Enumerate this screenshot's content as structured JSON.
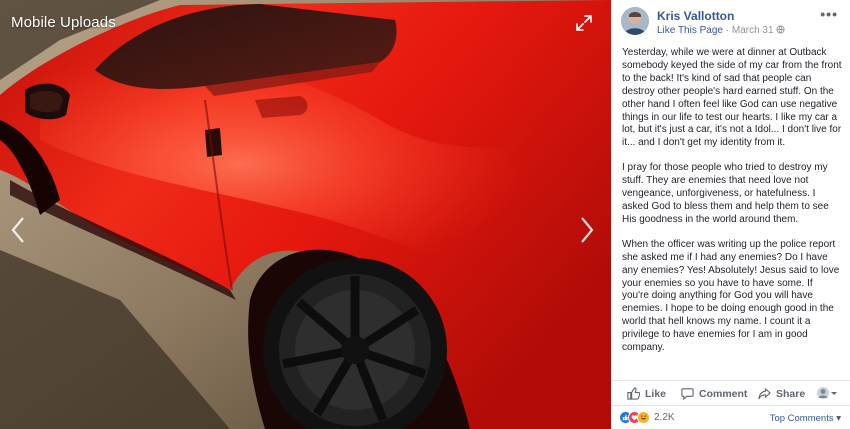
{
  "viewer": {
    "album_title": "Mobile Uploads"
  },
  "post": {
    "author": "Kris Vallotton",
    "like_page": "Like This Page",
    "date": "March 31",
    "paragraphs": [
      "Yesterday, while we were at dinner at Outback somebody keyed the side of my car from the front to the back! It's kind of sad that people can destroy other people's hard earned stuff. On the other hand I often feel like God can use negative things in our life to test our hearts. I like my car a lot, but it's just a car, it's not a Idol... I don't live for it... and I don't get my identity from it.",
      "I pray for those people who tried to destroy my stuff. They are enemies that need love not vengeance, unforgiveness, or hatefulness. I asked God to bless them and help them to see His goodness in the world around them.",
      "When the officer was writing up the police report she asked me if I had any enemies? Do I have any enemies? Yes! Absolutely! Jesus said to love your enemies so you have to have some. If you're doing anything for God you will have enemies. I hope to be doing enough good in the world that hell knows my name. I count it a privilege to have enemies for I am in good company."
    ]
  },
  "actions": {
    "like": "Like",
    "comment": "Comment",
    "share": "Share"
  },
  "reactions": {
    "count": "2.2K",
    "top_comments": "Top Comments ▾"
  },
  "colors": {
    "link_blue": "#365899",
    "car_red": "#e8140c",
    "like_blue": "#1877f2",
    "love_red": "#f33e58",
    "haha_yellow": "#f7b125"
  }
}
